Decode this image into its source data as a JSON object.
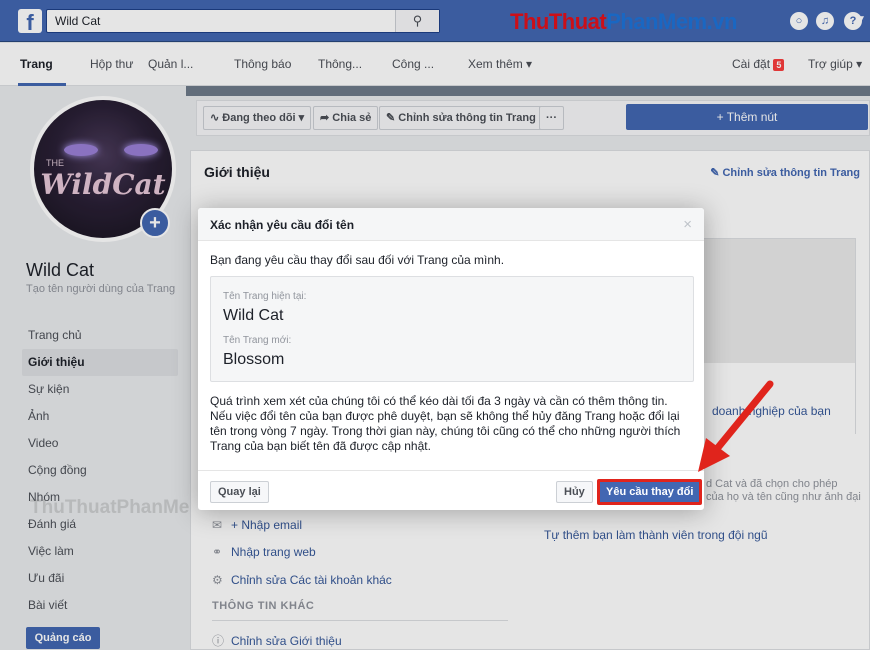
{
  "topbar": {
    "search_value": "Wild Cat",
    "search_icon": "search-icon",
    "watermark_part1": "ThuThuat",
    "watermark_part2": "PhanMem.vn"
  },
  "nav": {
    "tabs": [
      "Trang",
      "Hộp thư",
      "Quản l...",
      "Thông báo",
      "Thông...",
      "Công ...",
      "Xem thêm ▾"
    ],
    "settings": "Cài đặt",
    "settings_badge": "5",
    "help": "Trợ giúp ▾"
  },
  "sidebar": {
    "page_name": "Wild Cat",
    "username_hint": "Tạo tên người dùng của Trang",
    "items": [
      "Trang chủ",
      "Giới thiệu",
      "Sự kiện",
      "Ảnh",
      "Video",
      "Cộng đồng",
      "Nhóm",
      "Đánh giá",
      "Việc làm",
      "Ưu đãi",
      "Bài viết"
    ],
    "ads_button": "Quảng cáo",
    "watermark": "ThuThuatPhanMem.vn"
  },
  "profile": {
    "the": "THE",
    "logo": "WildCat"
  },
  "action_bar": {
    "following": "Đang theo dõi ▾",
    "share": "Chia sẻ",
    "edit_info": "Chỉnh sửa thông tin Trang",
    "more": "···",
    "add_button": "+ Thêm nút"
  },
  "intro": {
    "title": "Giới thiệu",
    "edit_link": "Chỉnh sửa thông tin Trang",
    "business": "doanh nghiệp của bạn",
    "right_text1": "d Cat và đã chọn cho phép",
    "right_text2": "của họ và tên cũng như ảnh đại",
    "right_link": "Tự thêm bạn làm thành viên trong đội ngũ",
    "add_email": "+ Nhập email",
    "add_website": "Nhập trang web",
    "edit_accounts": "Chỉnh sửa Các tài khoản khác",
    "other_info": "THÔNG TIN KHÁC",
    "edit_about": "Chỉnh sửa Giới thiệu"
  },
  "modal": {
    "title": "Xác nhận yêu cầu đổi tên",
    "close": "×",
    "intro": "Bạn đang yêu cầu thay đổi sau đối với Trang của mình.",
    "current_label": "Tên Trang hiện tại:",
    "current_value": "Wild Cat",
    "new_label": "Tên Trang mới:",
    "new_value": "Blossom",
    "body": "Quá trình xem xét của chúng tôi có thể kéo dài tối đa 3 ngày và cần có thêm thông tin. Nếu việc đổi tên của bạn được phê duyệt, bạn sẽ không thể hủy đăng Trang hoặc đổi lại tên trong vòng 7 ngày. Trong thời gian này, chúng tôi cũng có thể cho những người thích Trang của bạn biết tên đã được cập nhật.",
    "back_button": "Quay lại",
    "cancel_button": "Hủy",
    "submit_button": "Yêu cầu thay đổi"
  },
  "colors": {
    "brand": "#4267b2",
    "highlight": "#e0241c"
  }
}
